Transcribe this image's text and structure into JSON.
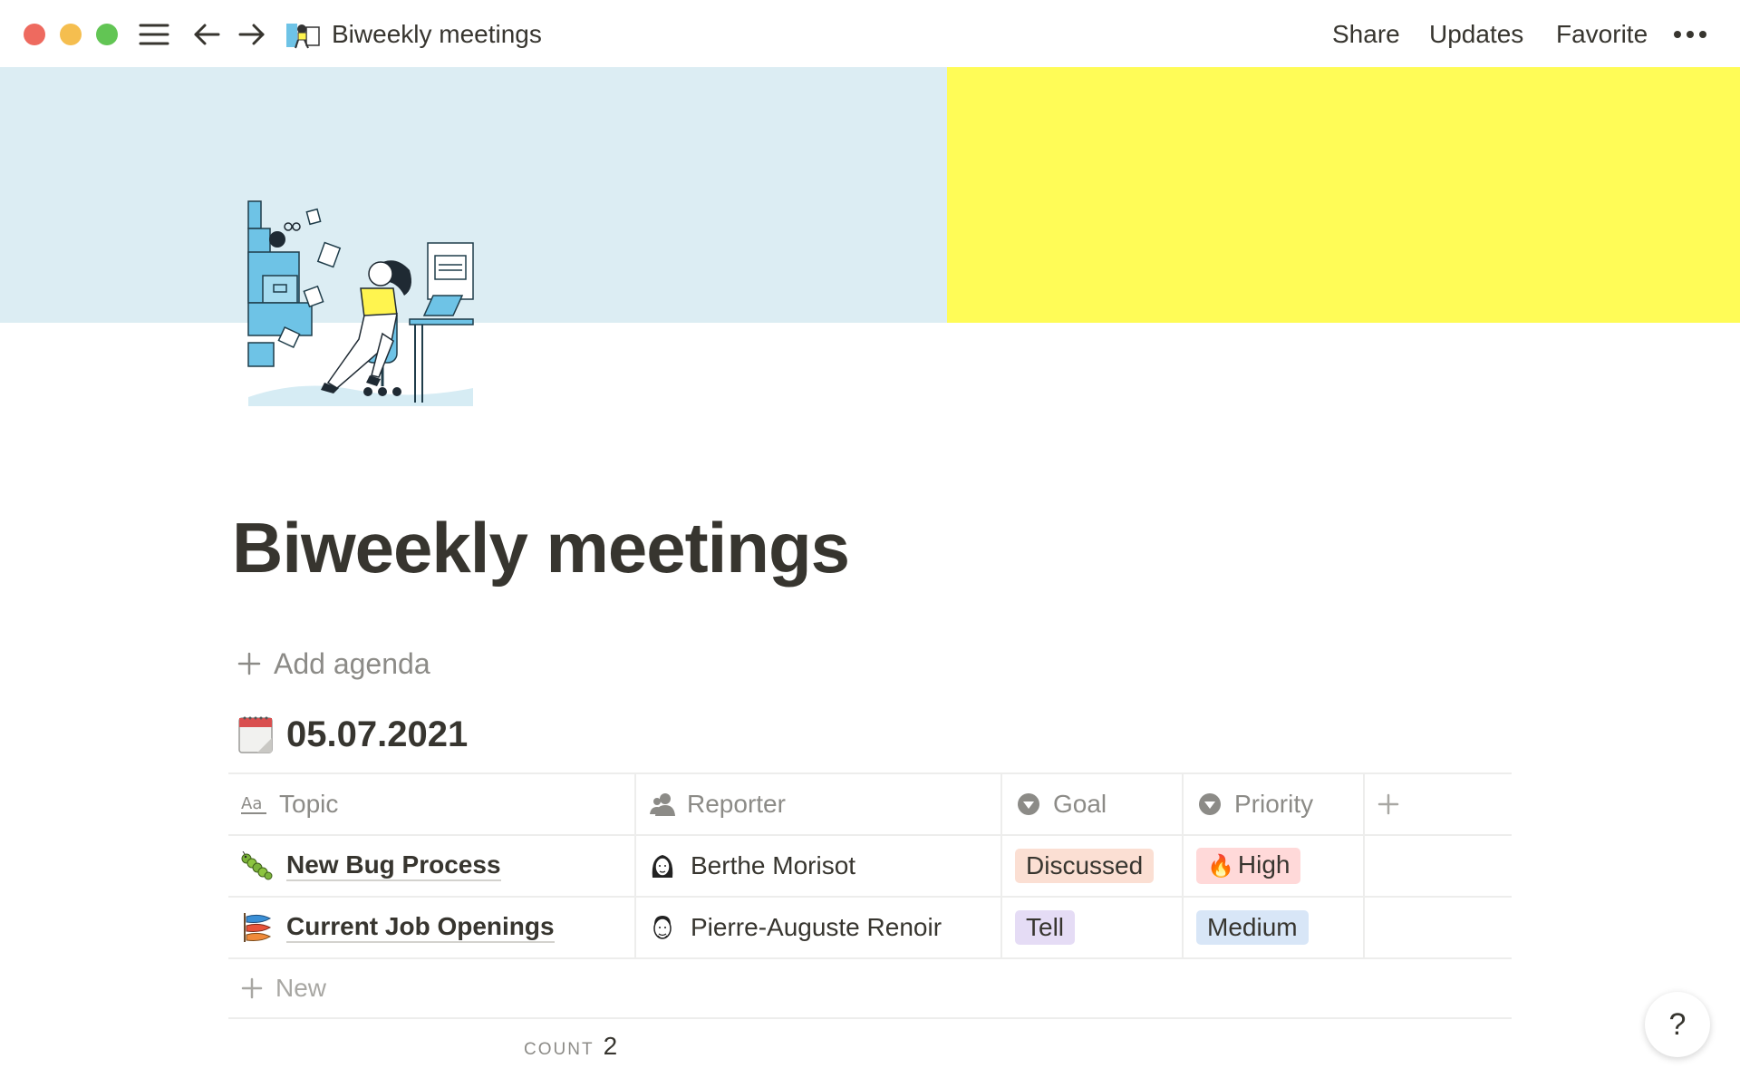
{
  "window": {
    "title": "Biweekly meetings",
    "actions": {
      "share": "Share",
      "updates": "Updates",
      "favorite": "Favorite",
      "more": "•••"
    }
  },
  "cover": {
    "colors": {
      "left": "#dcedf3",
      "right": "#fffc57"
    }
  },
  "page": {
    "title": "Biweekly meetings",
    "add_agenda": "Add agenda",
    "database_title": "05.07.2021"
  },
  "table": {
    "columns": [
      {
        "label": "Topic",
        "icon": "text-property-icon"
      },
      {
        "label": "Reporter",
        "icon": "person-property-icon"
      },
      {
        "label": "Goal",
        "icon": "select-property-icon"
      },
      {
        "label": "Priority",
        "icon": "select-property-icon"
      }
    ],
    "rows": [
      {
        "icon": "caterpillar-icon",
        "topic": "New Bug Process",
        "reporter": "Berthe Morisot",
        "goal": "Discussed",
        "priority": "High",
        "priority_emoji": "🔥"
      },
      {
        "icon": "fish-icon",
        "topic": "Current Job Openings",
        "reporter": "Pierre-Auguste Renoir",
        "goal": "Tell",
        "priority": "Medium"
      }
    ],
    "new_label": "New",
    "count_label": "COUNT",
    "count_value": "2"
  },
  "help": "?"
}
